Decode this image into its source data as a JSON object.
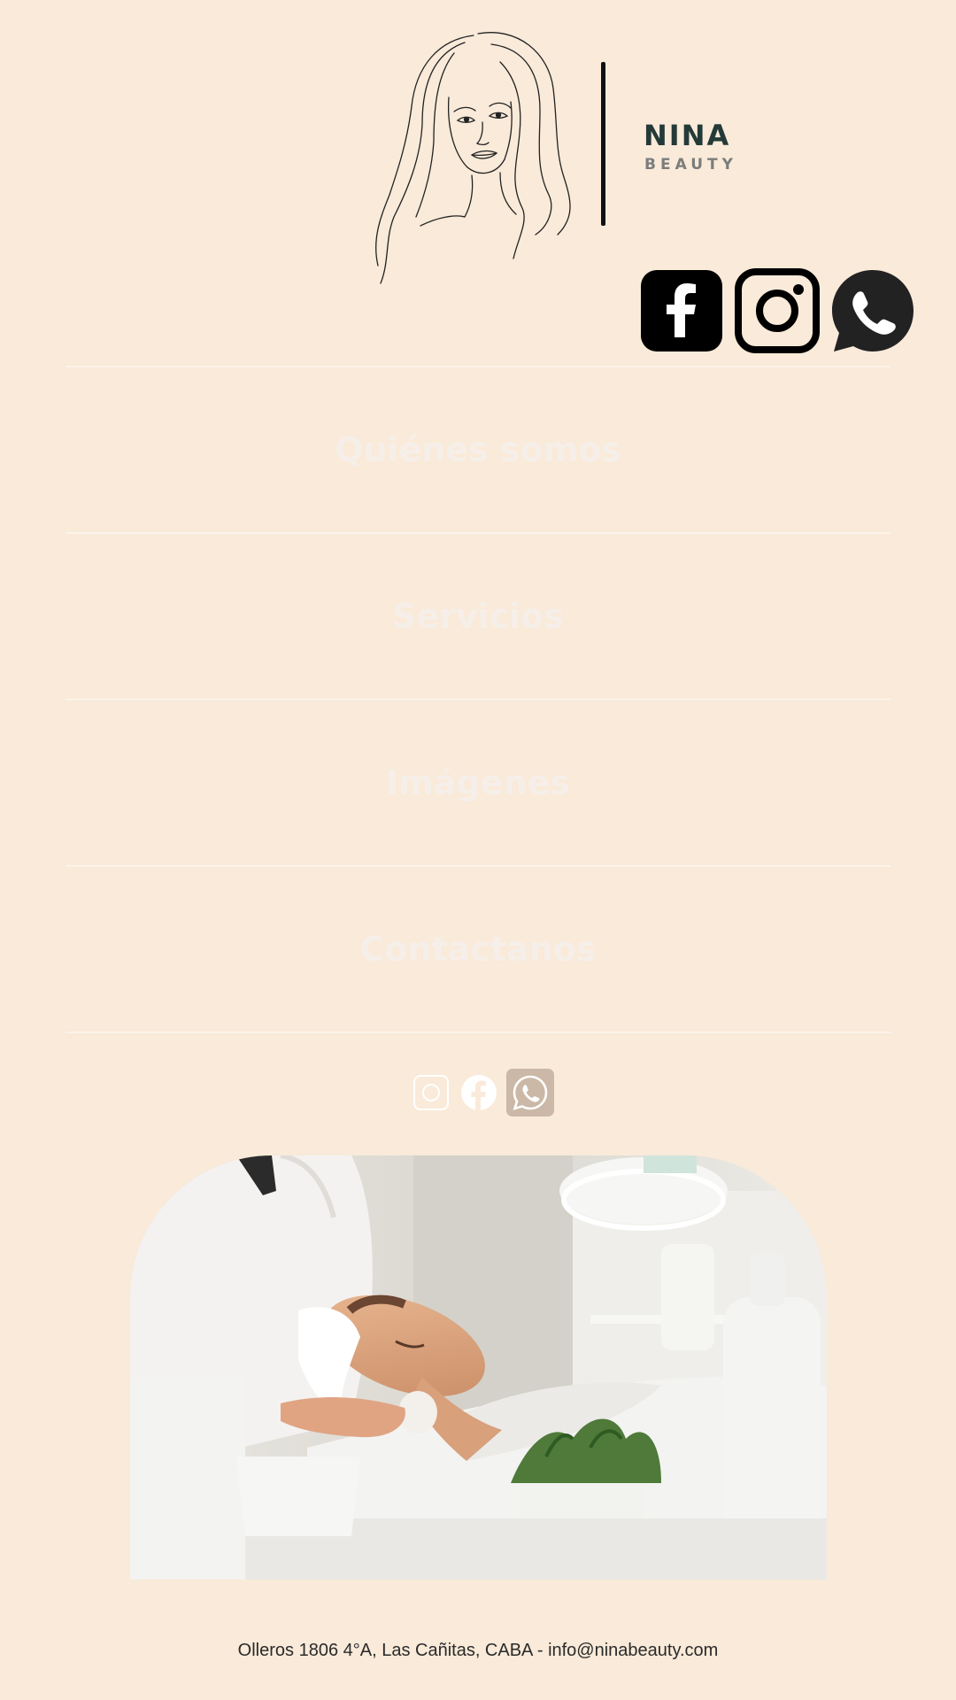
{
  "brand": {
    "name": "NINA",
    "subtitle": "BEAUTY"
  },
  "social_top": [
    {
      "icon": "facebook-icon"
    },
    {
      "icon": "instagram-icon"
    },
    {
      "icon": "whatsapp-icon"
    }
  ],
  "menu": {
    "items": [
      {
        "label": "Quiénes somos"
      },
      {
        "label": "Servicios"
      },
      {
        "label": "Imágenes"
      },
      {
        "label": "Contactanos"
      }
    ]
  },
  "social_small": [
    {
      "icon": "instagram-icon"
    },
    {
      "icon": "facebook-icon"
    },
    {
      "icon": "whatsapp-icon"
    }
  ],
  "footer": {
    "address": "Olleros 1806 4°A, Las Cañitas, CABA  - info@ninabeauty.com"
  },
  "colors": {
    "background": "#f9ead9",
    "brand_text": "#243a38",
    "menu_text": "#f6efe9",
    "whatsapp_box": "#cbb8a6"
  }
}
